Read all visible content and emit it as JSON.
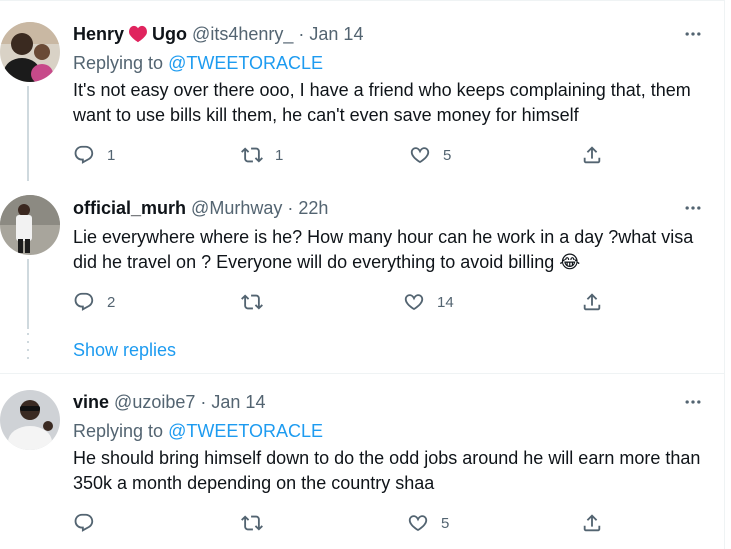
{
  "tweets": [
    {
      "name_first": "Henry",
      "name_last": "Ugo",
      "handle": "@its4henry_",
      "separator": "·",
      "time": "Jan 14",
      "replying_prefix": "Replying to ",
      "replying_to": "@TWEETORACLE",
      "text": "It's not easy over there ooo, I have a friend who keeps complaining that, them want to use bills kill them, he can't even save money for himself",
      "replies": "1",
      "retweets": "1",
      "likes": "5"
    },
    {
      "name": "official_murh",
      "handle": "@Murhway",
      "separator": "·",
      "time": "22h",
      "text": "Lie everywhere where is he? How many hour can he work in a day ?what visa did he travel on ? Everyone will do everything to avoid billing 😂",
      "replies": "2",
      "retweets": "",
      "likes": "14"
    },
    {
      "name": "vine",
      "handle": "@uzoibe7",
      "separator": "·",
      "time": "Jan 14",
      "replying_prefix": "Replying to ",
      "replying_to": "@TWEETORACLE",
      "text": "He should bring himself down to do the odd jobs around he will earn more than 350k a month depending on the country shaa",
      "replies": "",
      "retweets": "",
      "likes": "5"
    }
  ],
  "show_replies": "Show replies",
  "colors": {
    "accent": "#1d9bf0",
    "heart": "#e0245e",
    "muted": "#536471",
    "text": "#0f1419"
  },
  "icons": [
    "reply-icon",
    "retweet-icon",
    "like-icon",
    "share-icon",
    "more-icon",
    "heart-emoji-icon"
  ]
}
